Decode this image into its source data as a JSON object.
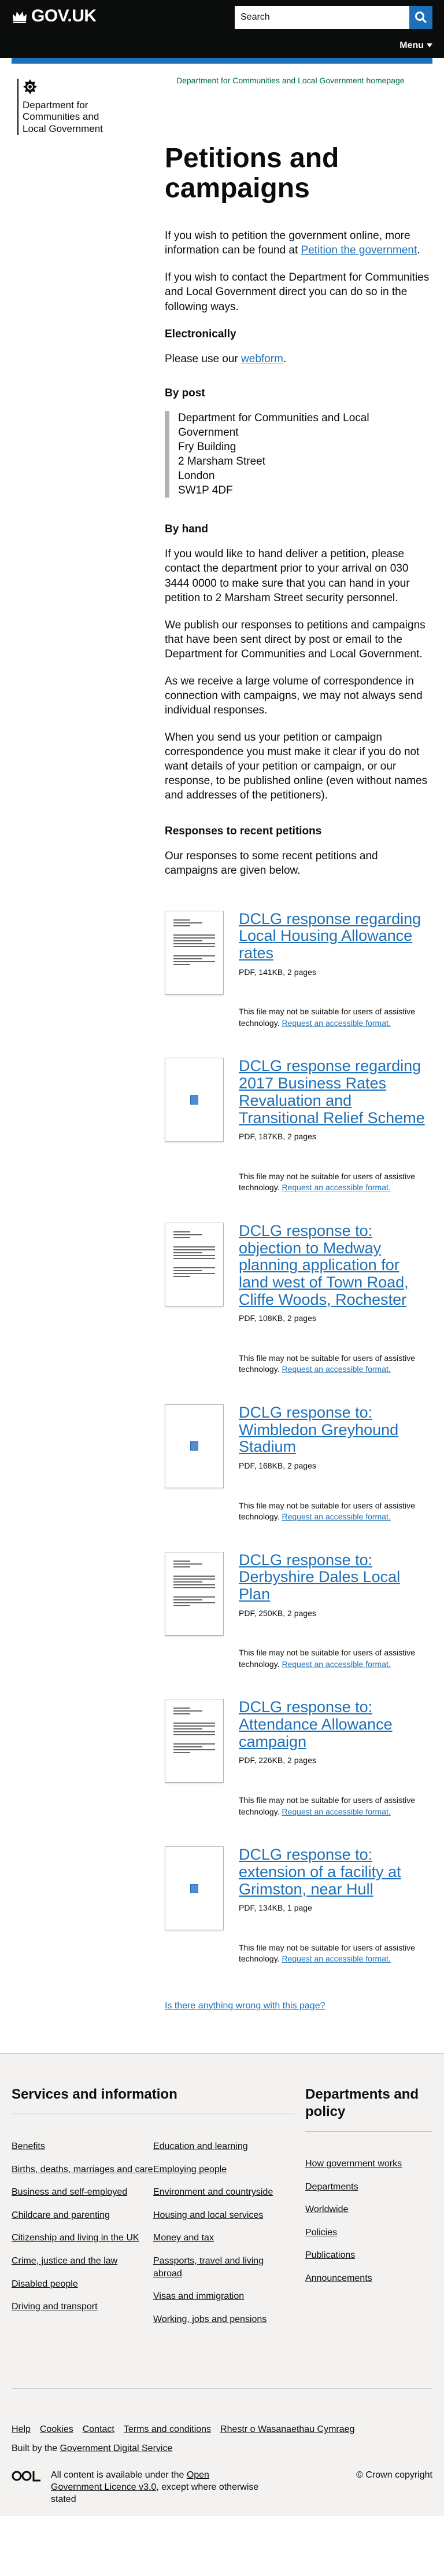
{
  "header": {
    "logo_text": "GOV.UK",
    "search_placeholder": "Search",
    "menu_label": "Menu"
  },
  "org": {
    "name_line1": "Department for",
    "name_line2": "Communities and",
    "name_line3": "Local Government",
    "homepage_link": "Department for Communities and Local Government homepage"
  },
  "page": {
    "title": "Petitions and campaigns",
    "intro1_pre": "If you wish to petition the government online, more information can be found at ",
    "intro1_link": "Petition the government",
    "intro1_post": ".",
    "intro2": "If you wish to contact the Department for Communities and Local Government direct you can do so in the following ways.",
    "electronically_heading": "Electronically",
    "webform_pre": "Please use our ",
    "webform_link": "webform",
    "webform_post": ".",
    "post_heading": "By post",
    "address": [
      "Department for Communities and Local Government",
      "Fry Building",
      "2 Marsham Street",
      "London",
      "SW1P 4DF"
    ],
    "hand_heading": "By hand",
    "hand_p1": "If you would like to hand deliver a petition, please contact the department prior to your arrival on 030 3444 0000 to make sure that you can hand in your petition to 2 Marsham Street security personnel.",
    "hand_p2": "We publish our responses to petitions and campaigns that have been sent direct by post or email to the Department for Communities and Local Government.",
    "hand_p3": "As we receive a large volume of correspondence in connection with campaigns, we may not always send individual responses.",
    "hand_p4": "When you send us your petition or campaign correspondence you must make it clear if you do not want details of your petition or campaign, or our response, to be published online (even without names and addresses of the petitioners).",
    "responses_heading": "Responses to recent petitions",
    "responses_intro": "Our responses to some recent petitions and campaigns are given below."
  },
  "attachments": [
    {
      "title": "DCLG response regarding Local Housing Allowance rates",
      "meta": "PDF, 141KB, 2 pages",
      "thumb": "text"
    },
    {
      "title": "DCLG response regarding 2017 Business Rates Revaluation and Transitional Relief Scheme",
      "meta": "PDF, 187KB, 2 pages",
      "thumb": "icon"
    },
    {
      "title": "DCLG response to: objection to Medway planning application for land west of Town Road, Cliffe Woods, Rochester",
      "meta": "PDF, 108KB, 2 pages",
      "thumb": "text"
    },
    {
      "title": "DCLG response to: Wimbledon Greyhound Stadium",
      "meta": "PDF, 168KB, 2 pages",
      "thumb": "icon"
    },
    {
      "title": "DCLG response to: Derbyshire Dales Local Plan",
      "meta": "PDF, 250KB, 2 pages",
      "thumb": "text"
    },
    {
      "title": "DCLG response to: Attendance Allowance campaign",
      "meta": "PDF, 226KB, 2 pages",
      "thumb": "text"
    },
    {
      "title": "DCLG response to: extension of a facility at Grimston, near Hull",
      "meta": "PDF, 134KB, 1 page",
      "thumb": "icon"
    }
  ],
  "accessibility": {
    "text": "This file may not be suitable for users of assistive technology. ",
    "link": "Request an accessible format."
  },
  "feedback_link": "Is there anything wrong with this page?",
  "footer": {
    "services_heading": "Services and information",
    "topics_col1": [
      "Benefits",
      "Births, deaths, marriages and care",
      "Business and self-employed",
      "Childcare and parenting",
      "Citizenship and living in the UK",
      "Crime, justice and the law",
      "Disabled people",
      "Driving and transport"
    ],
    "topics_col2": [
      "Education and learning",
      "Employing people",
      "Environment and countryside",
      "Housing and local services",
      "Money and tax",
      "Passports, travel and living abroad",
      "Visas and immigration",
      "Working, jobs and pensions"
    ],
    "departments_heading": "Departments and policy",
    "departments": [
      "How government works",
      "Departments",
      "Worldwide",
      "Policies",
      "Publications",
      "Announcements"
    ],
    "meta_links": [
      "Help",
      "Cookies",
      "Contact",
      "Terms and conditions",
      "Rhestr o Wasanaethau Cymraeg"
    ],
    "built_pre": "Built by the ",
    "built_link": "Government Digital Service",
    "licence_pre": "All content is available under the ",
    "licence_link": "Open Government Licence v3.0",
    "licence_post": ", except where otherwise stated",
    "copyright": "© Crown copyright"
  }
}
